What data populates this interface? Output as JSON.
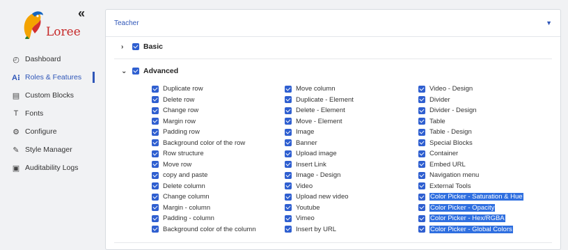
{
  "brand": {
    "logo_text": "Loree",
    "collapse_label": "«"
  },
  "sidebar": {
    "items": [
      {
        "label": "Dashboard",
        "icon": "dashboard-icon",
        "glyph": "◴",
        "active": false
      },
      {
        "label": "Roles & Features",
        "icon": "roles-icon",
        "glyph": "A⁝",
        "active": true
      },
      {
        "label": "Custom Blocks",
        "icon": "blocks-icon",
        "glyph": "▤",
        "active": false
      },
      {
        "label": "Fonts",
        "icon": "font-icon",
        "glyph": "T",
        "active": false
      },
      {
        "label": "Configure",
        "icon": "gear-icon",
        "glyph": "⚙",
        "active": false
      },
      {
        "label": "Style Manager",
        "icon": "brush-icon",
        "glyph": "✎",
        "active": false
      },
      {
        "label": "Auditability Logs",
        "icon": "log-icon",
        "glyph": "▣",
        "active": false
      }
    ]
  },
  "panel": {
    "role": "Teacher",
    "groups": [
      {
        "label": "Basic",
        "expanded": false,
        "chevron": "›"
      },
      {
        "label": "Advanced",
        "expanded": true,
        "chevron": "⌄"
      }
    ]
  },
  "features": {
    "col1": [
      "Duplicate row",
      "Delete row",
      "Change row",
      "Margin row",
      "Padding row",
      "Background color of the row",
      "Row structure",
      "Move row",
      "copy and paste",
      "Delete column",
      "Change column",
      "Margin - column",
      "Padding - column",
      "Background color of the column"
    ],
    "col2": [
      "Move column",
      "Duplicate - Element",
      "Delete - Element",
      "Move - Element",
      "Image",
      "Banner",
      "Upload image",
      "Insert Link",
      "Image - Design",
      "Video",
      "Upload new video",
      "Youtube",
      "Vimeo",
      "Insert by URL"
    ],
    "col3": [
      "Video - Design",
      "Divider",
      "Divider - Design",
      "Table",
      "Table - Design",
      "Special Blocks",
      "Container",
      "Embed URL",
      "Navigation menu",
      "External Tools",
      "Color Picker - Saturation & Hue",
      "Color Picker - Opacity",
      "Color Picker - Hex/RGBA",
      "Color Picker - Global Colors"
    ],
    "selected_text_items": [
      "Color Picker - Saturation & Hue",
      "Color Picker - Opacity",
      "Color Picker - Hex/RGBA",
      "Color Picker - Global Colors"
    ]
  },
  "colors": {
    "accent": "#2f56b8",
    "checkbox": "#2f5fd0",
    "selection": "#2f6fe0"
  }
}
